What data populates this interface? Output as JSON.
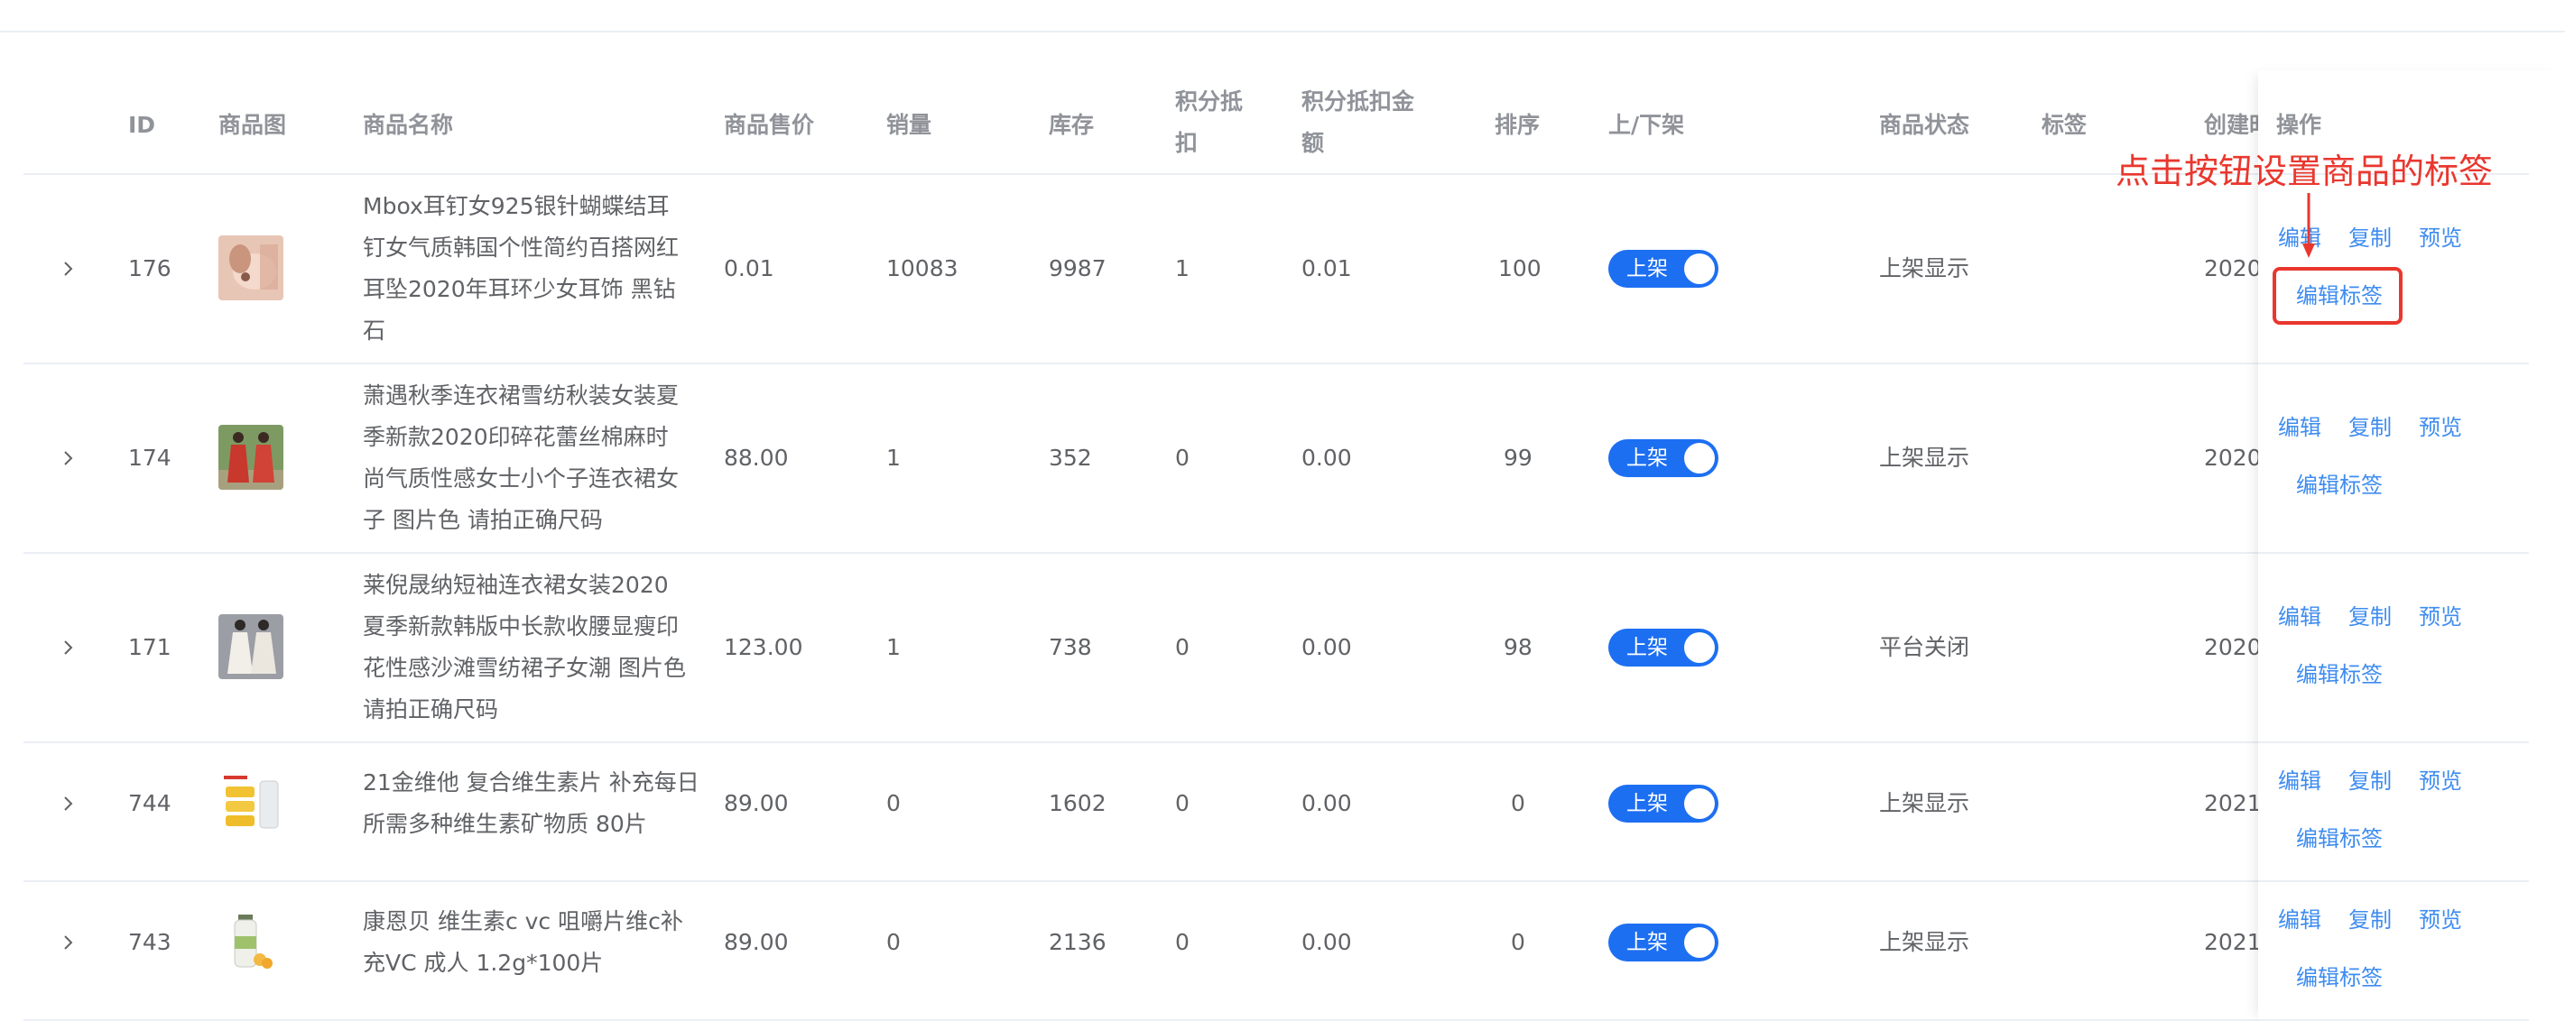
{
  "headers": {
    "id": "ID",
    "image": "商品图",
    "name": "商品名称",
    "price": "商品售价",
    "sales": "销量",
    "stock": "库存",
    "points_a": "积分抵",
    "points_b": "扣",
    "points_amount_a": "积分抵扣金",
    "points_amount_b": "额",
    "sort": "排序",
    "onoff": "上/下架",
    "status": "商品状态",
    "tags": "标签",
    "created": "创建时",
    "ops": "操作"
  },
  "annotation": {
    "text": "点击按钮设置商品的标签"
  },
  "rows": [
    {
      "id": "176",
      "name": "Mbox耳钉女925银针蝴蝶结耳钉女气质韩国个性简约百搭网红耳坠2020年耳环少女耳饰 黑钻石",
      "price": "0.01",
      "sales": "10083",
      "stock": "9987",
      "points": "1",
      "points_amount": "0.01",
      "sort": "100",
      "switch_label": "上架",
      "status": "上架显示",
      "created": "2020-",
      "op_edit": "编辑",
      "op_copy": "复制",
      "op_preview": "预览",
      "op_tags": "编辑标签",
      "thumb": "earring"
    },
    {
      "id": "174",
      "name": "萧遇秋季连衣裙雪纺秋装女装夏季新款2020印碎花蕾丝棉麻时尚气质性感女士小个子连衣裙女子 图片色 请拍正确尺码",
      "price": "88.00",
      "sales": "1",
      "stock": "352",
      "points": "0",
      "points_amount": "0.00",
      "sort": "99",
      "switch_label": "上架",
      "status": "上架显示",
      "created": "2020-",
      "op_edit": "编辑",
      "op_copy": "复制",
      "op_preview": "预览",
      "op_tags": "编辑标签",
      "thumb": "red-dress"
    },
    {
      "id": "171",
      "name": "莱倪晟纳短袖连衣裙女装2020夏季新款韩版中长款收腰显瘦印花性感沙滩雪纺裙子女潮 图片色 请拍正确尺码",
      "price": "123.00",
      "sales": "1",
      "stock": "738",
      "points": "0",
      "points_amount": "0.00",
      "sort": "98",
      "switch_label": "上架",
      "status": "平台关闭",
      "created": "2020-",
      "op_edit": "编辑",
      "op_copy": "复制",
      "op_preview": "预览",
      "op_tags": "编辑标签",
      "thumb": "white-dress"
    },
    {
      "id": "744",
      "name": "21金维他 复合维生素片 补充每日所需多种维生素矿物质 80片",
      "price": "89.00",
      "sales": "0",
      "stock": "1602",
      "points": "0",
      "points_amount": "0.00",
      "sort": "0",
      "switch_label": "上架",
      "status": "上架显示",
      "created": "2021-",
      "op_edit": "编辑",
      "op_copy": "复制",
      "op_preview": "预览",
      "op_tags": "编辑标签",
      "thumb": "vitamin-box"
    },
    {
      "id": "743",
      "name": "康恩贝 维生素c vc 咀嚼片维c补充VC 成人 1.2g*100片",
      "price": "89.00",
      "sales": "0",
      "stock": "2136",
      "points": "0",
      "points_amount": "0.00",
      "sort": "0",
      "switch_label": "上架",
      "status": "上架显示",
      "created": "2021-",
      "op_edit": "编辑",
      "op_copy": "复制",
      "op_preview": "预览",
      "op_tags": "编辑标签",
      "thumb": "vitamin-bottle"
    }
  ]
}
